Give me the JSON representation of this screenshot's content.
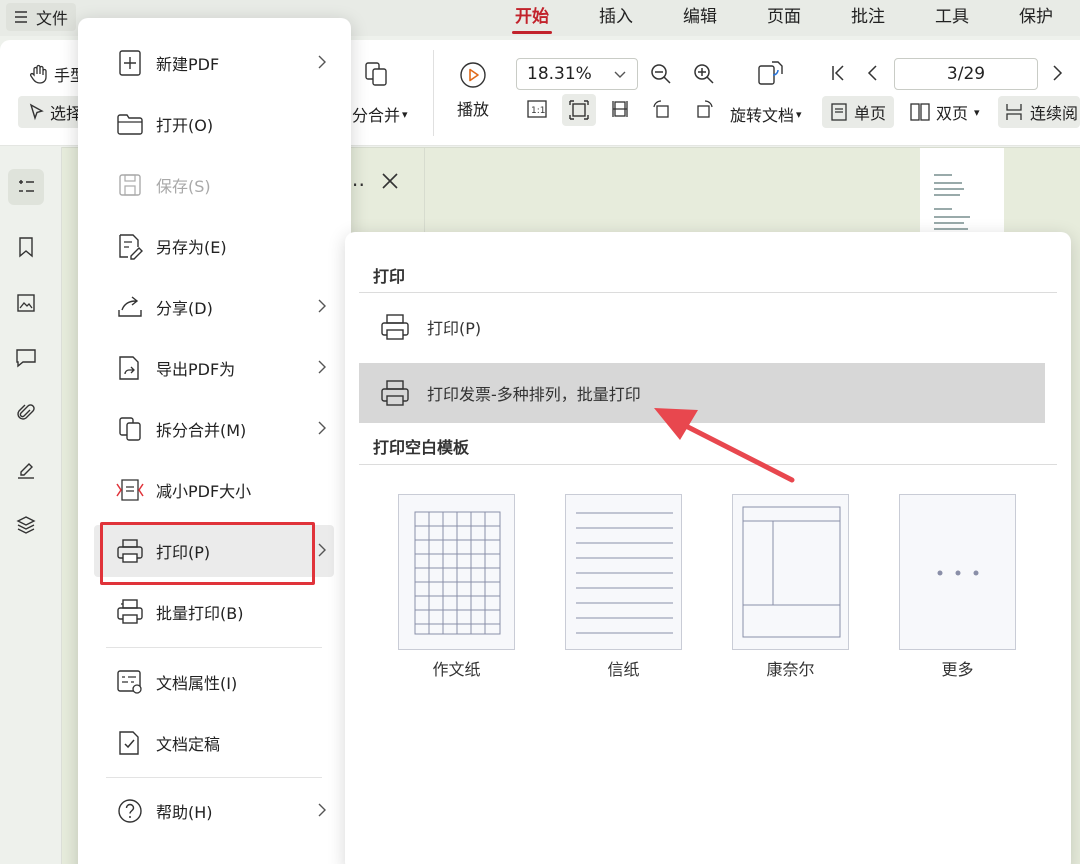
{
  "topbar": {
    "file_menu_label": "文件",
    "tabs": [
      "开始",
      "插入",
      "编辑",
      "页面",
      "批注",
      "工具",
      "保护"
    ],
    "active_tab": "开始"
  },
  "ribbon": {
    "hand_label": "手型",
    "select_label": "选择",
    "split_merge_label": "分合并",
    "play_label": "播放",
    "zoom_value": "18.31%",
    "page_value": "3/29",
    "rotate_label": "旋转文档",
    "single_page_label": "单页",
    "double_page_label": "双页",
    "continuous_label": "连续阅"
  },
  "file_menu": {
    "items": [
      {
        "label": "新建PDF",
        "icon": "new-pdf-icon",
        "submenu": true,
        "disabled": false
      },
      {
        "label": "打开(O)",
        "icon": "folder-open-icon",
        "submenu": false,
        "disabled": false
      },
      {
        "label": "保存(S)",
        "icon": "save-icon",
        "submenu": false,
        "disabled": true
      },
      {
        "label": "另存为(E)",
        "icon": "save-as-icon",
        "submenu": false,
        "disabled": false
      },
      {
        "label": "分享(D)",
        "icon": "share-icon",
        "submenu": true,
        "disabled": false
      },
      {
        "label": "导出PDF为",
        "icon": "export-pdf-icon",
        "submenu": true,
        "disabled": false
      },
      {
        "label": "拆分合并(M)",
        "icon": "split-merge-icon",
        "submenu": true,
        "disabled": false
      },
      {
        "label": "减小PDF大小",
        "icon": "compress-pdf-icon",
        "submenu": false,
        "disabled": false
      },
      {
        "label": "打印(P)",
        "icon": "printer-icon",
        "submenu": true,
        "disabled": false,
        "selected": true
      },
      {
        "label": "批量打印(B)",
        "icon": "batch-print-icon",
        "submenu": false,
        "disabled": false
      },
      {
        "label": "文档属性(I)",
        "icon": "doc-properties-icon",
        "submenu": false,
        "disabled": false
      },
      {
        "label": "文档定稿",
        "icon": "doc-finalize-icon",
        "submenu": false,
        "disabled": false
      },
      {
        "label": "帮助(H)",
        "icon": "help-icon",
        "submenu": true,
        "disabled": false
      }
    ]
  },
  "print_panel": {
    "section_print": "打印",
    "print_item": "打印(P)",
    "invoice_item": "打印发票-多种排列，批量打印",
    "section_templates": "打印空白模板",
    "templates": [
      "作文纸",
      "信纸",
      "康奈尔",
      "更多"
    ]
  },
  "colors": {
    "accent": "#c2222b",
    "highlight_border": "#e0333a",
    "arrow": "#e8474e"
  }
}
